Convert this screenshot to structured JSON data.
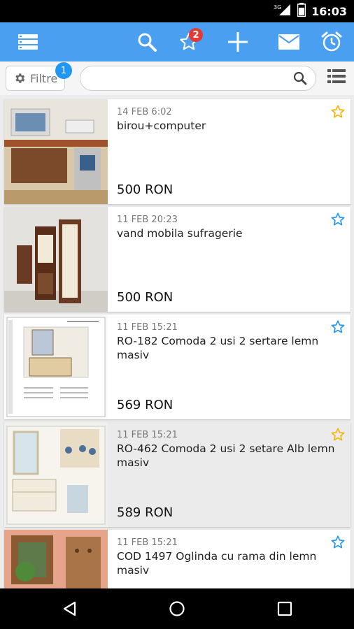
{
  "status_bar": {
    "network": "3G",
    "time": "16:03"
  },
  "app_bar": {
    "icons": [
      "menu-icon",
      "search-icon",
      "star-icon",
      "plus-icon",
      "mail-icon",
      "alarm-icon"
    ],
    "favorites_badge": "2",
    "accent": "#4a9ff0"
  },
  "filter_bar": {
    "filter_label": "Filtre",
    "filter_badge": "1",
    "search_value": "",
    "search_placeholder": ""
  },
  "listings": [
    {
      "date": "14 FEB 6:02",
      "title": "birou+computer",
      "price": "500 RON",
      "star": "gold"
    },
    {
      "date": "11 FEB 20:23",
      "title": "vand mobila sufragerie",
      "price": "500 RON",
      "star": "blue"
    },
    {
      "date": "11 FEB 15:21",
      "title": "RO-182 Comoda 2 usi 2 sertare lemn masiv",
      "price": "569 RON",
      "star": "blue"
    },
    {
      "date": "11 FEB 15:21",
      "title": "RO-462 Comoda 2 usi 2 setare Alb lemn masiv",
      "price": "589 RON",
      "star": "gold"
    },
    {
      "date": "11 FEB 15:21",
      "title": "COD 1497 Oglinda cu rama din lemn masiv",
      "price": "",
      "star": "blue"
    }
  ],
  "colors": {
    "star_gold": "#f4b400",
    "star_blue": "#2196f3",
    "badge_red": "#e53935",
    "badge_blue": "#2196f3"
  }
}
